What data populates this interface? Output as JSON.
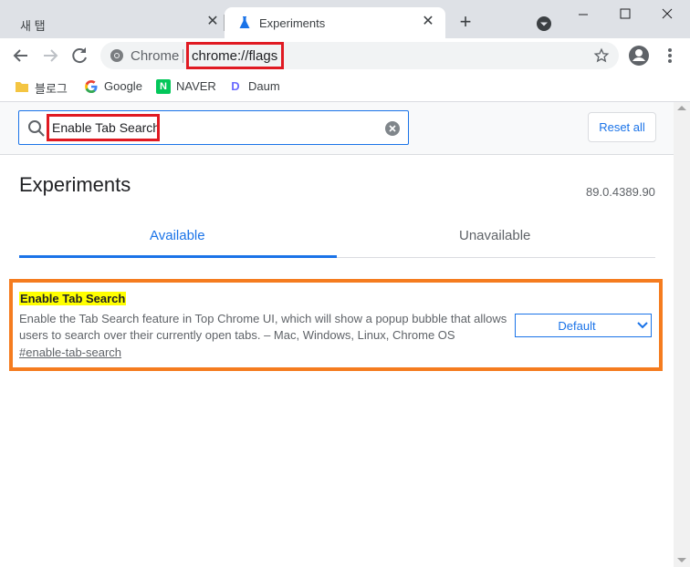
{
  "tabs": [
    {
      "title": "새 탭",
      "active": false
    },
    {
      "title": "Experiments",
      "active": true
    }
  ],
  "omnibox": {
    "site_label": "Chrome",
    "url": "chrome://flags"
  },
  "bookmarks": [
    {
      "label": "블로그",
      "icon": "folder-icon"
    },
    {
      "label": "Google",
      "icon": "google-icon"
    },
    {
      "label": "NAVER",
      "icon": "naver-icon",
      "icon_text": "N"
    },
    {
      "label": "Daum",
      "icon": "daum-icon",
      "icon_text": "D"
    }
  ],
  "search": {
    "value": "Enable Tab Search"
  },
  "reset_all_label": "Reset all",
  "page": {
    "title": "Experiments",
    "version": "89.0.4389.90"
  },
  "content_tabs": [
    {
      "label": "Available",
      "active": true
    },
    {
      "label": "Unavailable",
      "active": false
    }
  ],
  "flag": {
    "name": "Enable Tab Search",
    "description": "Enable the Tab Search feature in Top Chrome UI, which will show a popup bubble that allows users to search over their currently open tabs. – Mac, Windows, Linux, Chrome OS",
    "link": "#enable-tab-search",
    "selected": "Default"
  },
  "colors": {
    "accent": "#1a73e8",
    "highlight": "#ffff00",
    "annotation_red": "#e01a22",
    "annotation_orange": "#f57c1f"
  }
}
